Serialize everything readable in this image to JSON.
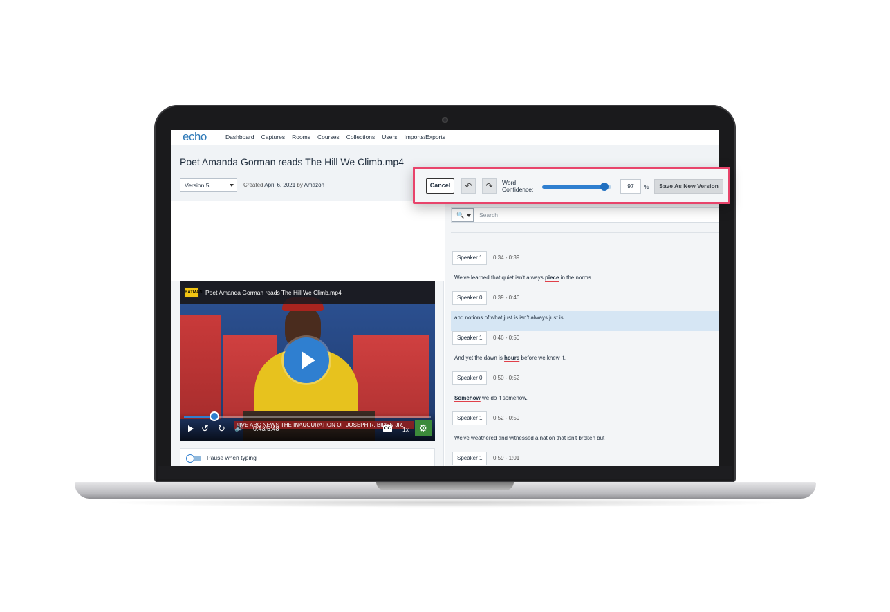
{
  "app": {
    "logo": "echo"
  },
  "nav": {
    "items": [
      "Dashboard",
      "Captures",
      "Rooms",
      "Courses",
      "Collections",
      "Users",
      "Imports/Exports"
    ]
  },
  "page": {
    "title": "Poet Amanda Gorman reads The Hill We Climb.mp4",
    "version_selected": "Version 5",
    "created_prefix": "Created",
    "created_date": "April 6, 2021",
    "created_by_prefix": "by",
    "created_by": "Amazon"
  },
  "toolbar": {
    "cancel_label": "Cancel",
    "undo_icon": "undo-icon",
    "redo_icon": "redo-icon",
    "word_label_line1": "Word",
    "word_label_line2": "Confidence:",
    "confidence_value": "97",
    "confidence_fraction": 0.9,
    "percent_sign": "%",
    "save_label": "Save As New Version"
  },
  "video": {
    "title": "Poet Amanda Gorman reads The Hill We Climb.mp4",
    "channel_badge": "BATMAN",
    "lower_third": "LIVE  ABC NEWS  THE INAUGURATION OF JOSEPH R. BIDEN JR.",
    "time": "0:43/5:48",
    "progress_fraction": 0.124,
    "cc_label": "CC",
    "speed_label": "1x",
    "accent": "#2f7fd0"
  },
  "pause": {
    "label": "Pause when typing"
  },
  "search": {
    "placeholder": "Search"
  },
  "transcript": [
    {
      "speaker": "Speaker 1",
      "time": "0:34 - 0:39",
      "parts": [
        [
          "We've learned that quiet isn't always ",
          false
        ],
        [
          "piece",
          true
        ],
        [
          " in the norms",
          false
        ]
      ],
      "highlight": false
    },
    {
      "speaker": "Speaker 0",
      "time": "0:39 - 0:46",
      "parts": [
        [
          "and notions of what just is isn't always just is.",
          false
        ]
      ],
      "highlight": true
    },
    {
      "speaker": "Speaker 1",
      "time": "0:46 - 0:50",
      "parts": [
        [
          "And yet the dawn is ",
          false
        ],
        [
          "hours",
          true
        ],
        [
          " before we knew it.",
          false
        ]
      ],
      "highlight": false
    },
    {
      "speaker": "Speaker 0",
      "time": "0:50 - 0:52",
      "parts": [
        [
          "Somehow",
          true
        ],
        [
          " we do it somehow.",
          false
        ]
      ],
      "highlight": false
    },
    {
      "speaker": "Speaker 1",
      "time": "0:52 - 0:59",
      "parts": [
        [
          "We've weathered and witnessed a nation that isn't broken but",
          false
        ]
      ],
      "highlight": false
    },
    {
      "speaker": "Speaker 1",
      "time": "0:59 - 1:01",
      "parts": [],
      "highlight": false
    }
  ],
  "colors": {
    "brand": "#2f7ab8",
    "highlight_box": "#e8446b",
    "low_confidence_underline": "#e0404a"
  }
}
